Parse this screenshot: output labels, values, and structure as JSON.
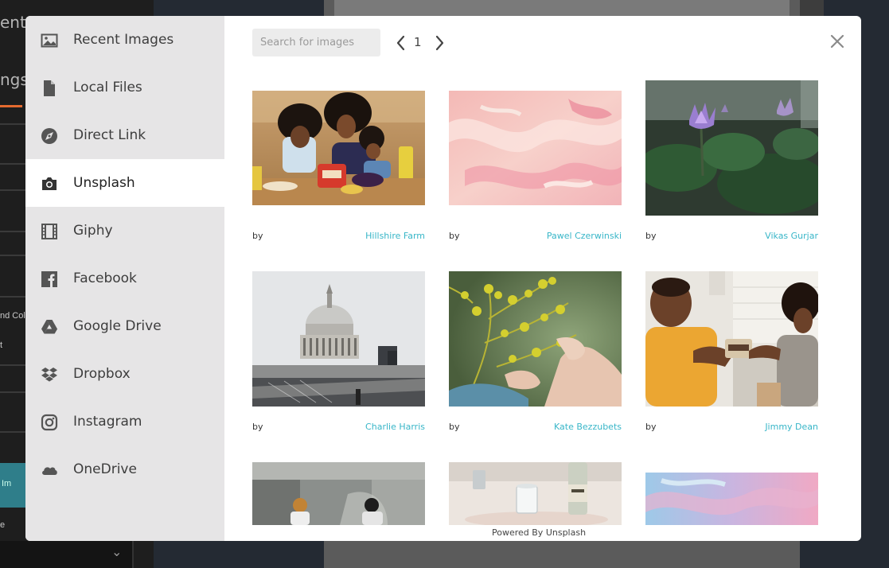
{
  "background_app": {
    "title_fragment": "ents",
    "settings_fragment": "ngs",
    "side_fragment_1": "nd Col",
    "side_fragment_2": "t",
    "side_fragment_3": "e",
    "teal_fragment": "Im"
  },
  "sidebar": {
    "items": [
      {
        "label": "Recent Images",
        "icon": "image-icon",
        "active": false
      },
      {
        "label": "Local Files",
        "icon": "file-icon",
        "active": false
      },
      {
        "label": "Direct Link",
        "icon": "compass-link-icon",
        "active": false
      },
      {
        "label": "Unsplash",
        "icon": "camera-icon",
        "active": true
      },
      {
        "label": "Giphy",
        "icon": "film-icon",
        "active": false
      },
      {
        "label": "Facebook",
        "icon": "facebook-icon",
        "active": false
      },
      {
        "label": "Google Drive",
        "icon": "google-drive-icon",
        "active": false
      },
      {
        "label": "Dropbox",
        "icon": "dropbox-icon",
        "active": false
      },
      {
        "label": "Instagram",
        "icon": "instagram-icon",
        "active": false
      },
      {
        "label": "OneDrive",
        "icon": "onedrive-icon",
        "active": false
      }
    ]
  },
  "toolbar": {
    "search_placeholder": "Search for images",
    "page": "1",
    "prev_icon": "chevron-left-icon",
    "next_icon": "chevron-right-icon",
    "close_icon": "close-icon"
  },
  "photos": [
    {
      "by": "by",
      "author": "Hillshire Farm",
      "subject": "family-snack-photo"
    },
    {
      "by": "by",
      "author": "Pawel Czerwinski",
      "subject": "pink-marble-photo"
    },
    {
      "by": "by",
      "author": "Vikas Gurjar",
      "subject": "lotus-flowers-photo"
    },
    {
      "by": "by",
      "author": "Charlie Harris",
      "subject": "cathedral-dome-photo"
    },
    {
      "by": "by",
      "author": "Kate Bezzubets",
      "subject": "yellow-plant-photo"
    },
    {
      "by": "by",
      "author": "Jimmy Dean",
      "subject": "kitchen-couple-photo"
    },
    {
      "by": "",
      "author": "",
      "subject": "motorcyclists-photo"
    },
    {
      "by": "",
      "author": "",
      "subject": "glass-bottles-photo"
    },
    {
      "by": "",
      "author": "",
      "subject": "blue-pink-marble-photo"
    }
  ],
  "footer": {
    "powered_by": "Powered By Unsplash"
  },
  "colors": {
    "accent_link": "#38b6c8",
    "sidebar_bg": "#e6e5e6",
    "active_item_bg": "#ffffff"
  }
}
